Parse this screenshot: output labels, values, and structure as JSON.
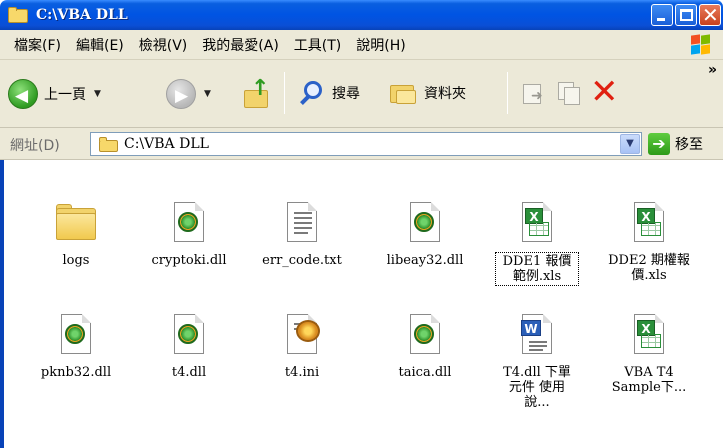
{
  "window": {
    "title": "C:\\VBA DLL"
  },
  "menu": [
    "檔案(F)",
    "編輯(E)",
    "檢視(V)",
    "我的最愛(A)",
    "工具(T)",
    "說明(H)"
  ],
  "toolbar": {
    "back_label": "上一頁",
    "search_label": "搜尋",
    "folders_label": "資料夾",
    "overflow": "»"
  },
  "address": {
    "label": "網址(D)",
    "value": "C:\\VBA DLL",
    "go_label": "移至"
  },
  "colors": {
    "titlebar": "#0054e3",
    "chrome": "#ece9d8",
    "delete": "#e02010"
  },
  "files": [
    {
      "name": "logs",
      "type": "folder"
    },
    {
      "name": "cryptoki.dll",
      "type": "dll"
    },
    {
      "name": "err_code.txt",
      "type": "txt"
    },
    {
      "name": "libeay32.dll",
      "type": "dll"
    },
    {
      "name": "DDE1 報價範例.xls",
      "type": "xls",
      "selected": true
    },
    {
      "name": "DDE2 期權報價.xls",
      "type": "xls"
    },
    {
      "name": "pknb32.dll",
      "type": "dll"
    },
    {
      "name": "t4.dll",
      "type": "dll"
    },
    {
      "name": "t4.ini",
      "type": "ini"
    },
    {
      "name": "taica.dll",
      "type": "dll"
    },
    {
      "name": "T4.dll 下單元件 使用說...",
      "type": "doc"
    },
    {
      "name": "VBA T4 Sample下...",
      "type": "xls"
    }
  ]
}
